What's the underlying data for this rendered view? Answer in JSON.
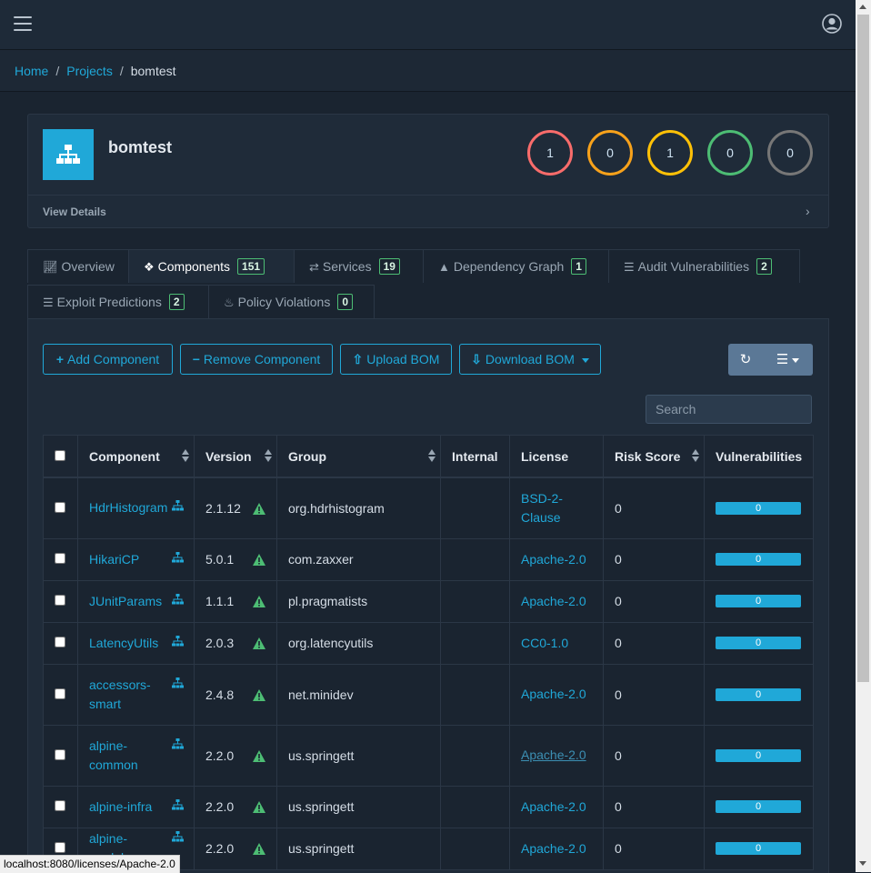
{
  "breadcrumb": {
    "home": "Home",
    "projects": "Projects",
    "current": "bomtest"
  },
  "project": {
    "name": "bomtest",
    "view_details": "View Details",
    "severity_counts": [
      {
        "value": "1",
        "color": "#f86c6b"
      },
      {
        "value": "0",
        "color": "#f7a21b"
      },
      {
        "value": "1",
        "color": "#ffc107"
      },
      {
        "value": "0",
        "color": "#4dbd74"
      },
      {
        "value": "0",
        "color": "#777777"
      }
    ]
  },
  "tabs": {
    "overview": {
      "label": "Overview"
    },
    "components": {
      "label": "Components",
      "count": "151"
    },
    "services": {
      "label": "Services",
      "count": "19"
    },
    "dependency_graph": {
      "label": "Dependency Graph",
      "count": "1"
    },
    "audit": {
      "label": "Audit Vulnerabilities",
      "count": "2"
    },
    "exploit": {
      "label": "Exploit Predictions",
      "count": "2"
    },
    "policy": {
      "label": "Policy Violations",
      "count": "0"
    }
  },
  "toolbar": {
    "add": "Add Component",
    "remove": "Remove Component",
    "upload": "Upload BOM",
    "download": "Download BOM"
  },
  "search": {
    "placeholder": "Search"
  },
  "table": {
    "headers": {
      "component": "Component",
      "version": "Version",
      "group": "Group",
      "internal": "Internal",
      "license": "License",
      "risk": "Risk Score",
      "vulns": "Vulnerabilities"
    },
    "rows": [
      {
        "component": "HdrHistogram",
        "version": "2.1.12",
        "group": "org.hdrhistogram",
        "internal": "",
        "license": "BSD-2-Clause",
        "risk": "0",
        "vulns": "0"
      },
      {
        "component": "HikariCP",
        "version": "5.0.1",
        "group": "com.zaxxer",
        "internal": "",
        "license": "Apache-2.0",
        "risk": "0",
        "vulns": "0"
      },
      {
        "component": "JUnitParams",
        "version": "1.1.1",
        "group": "pl.pragmatists",
        "internal": "",
        "license": "Apache-2.0",
        "risk": "0",
        "vulns": "0"
      },
      {
        "component": "LatencyUtils",
        "version": "2.0.3",
        "group": "org.latencyutils",
        "internal": "",
        "license": "CC0-1.0",
        "risk": "0",
        "vulns": "0"
      },
      {
        "component": "accessors-smart",
        "version": "2.4.8",
        "group": "net.minidev",
        "internal": "",
        "license": "Apache-2.0",
        "risk": "0",
        "vulns": "0"
      },
      {
        "component": "alpine-common",
        "version": "2.2.0",
        "group": "us.springett",
        "internal": "",
        "license": "Apache-2.0",
        "risk": "0",
        "vulns": "0"
      },
      {
        "component": "alpine-infra",
        "version": "2.2.0",
        "group": "us.springett",
        "internal": "",
        "license": "Apache-2.0",
        "risk": "0",
        "vulns": "0"
      },
      {
        "component": "alpine-model",
        "version": "2.2.0",
        "group": "us.springett",
        "internal": "",
        "license": "Apache-2.0",
        "risk": "0",
        "vulns": "0"
      }
    ]
  },
  "statusbar": {
    "url": "localhost:8080/licenses/Apache-2.0"
  },
  "colors": {
    "accent": "#20a8d8",
    "success": "#4dbd74",
    "background": "#1a2430"
  }
}
